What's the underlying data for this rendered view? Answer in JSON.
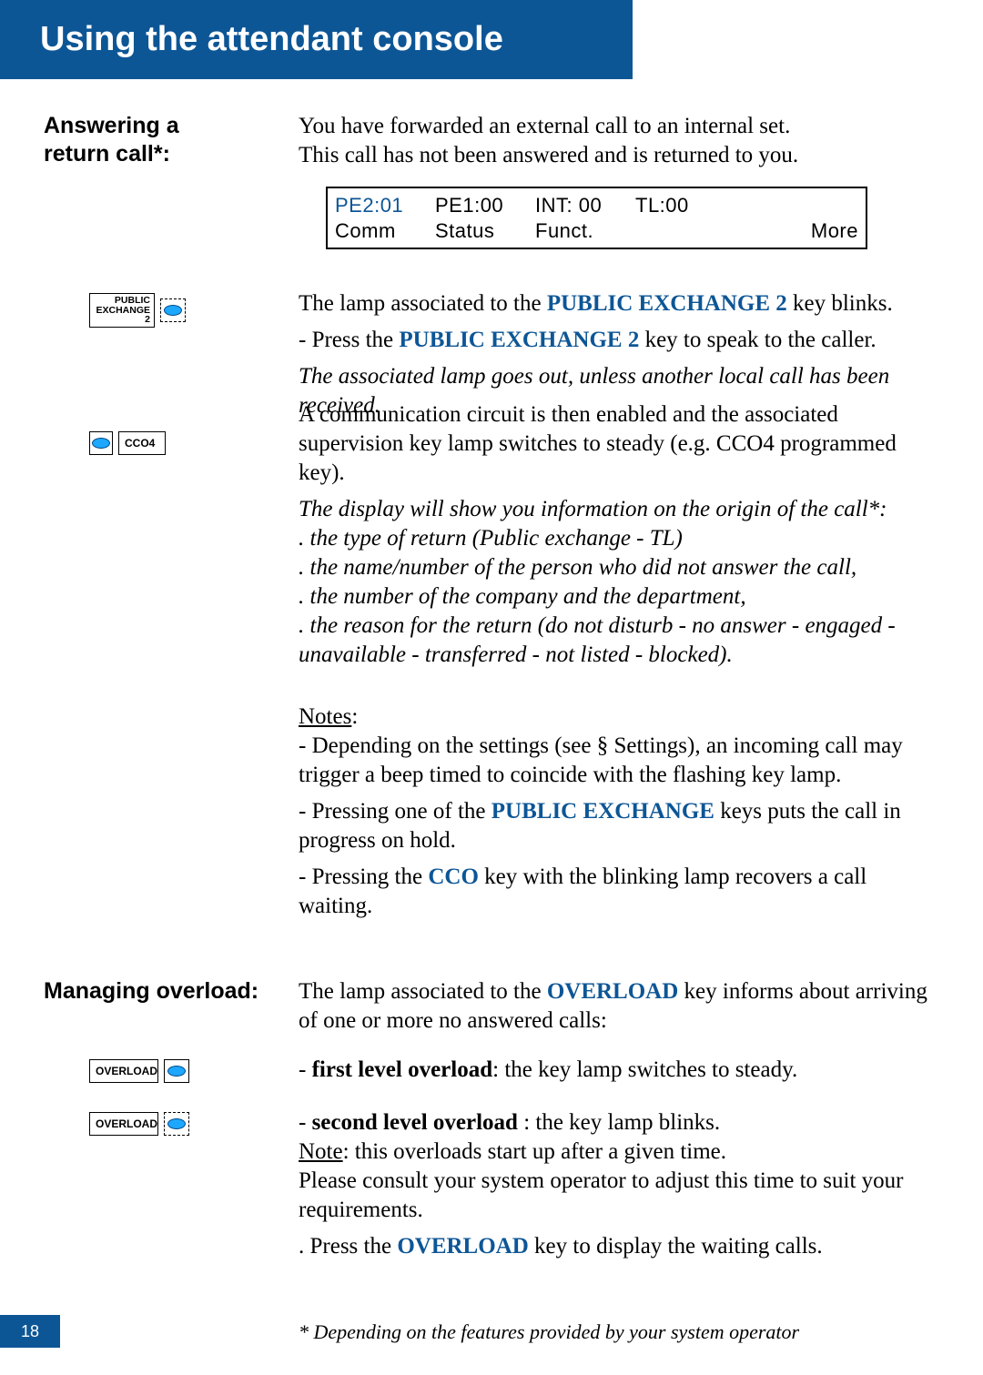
{
  "banner": "Using the attendant console",
  "sections": {
    "answering": {
      "heading_line1": "Answering a",
      "heading_line2": "return call*:",
      "intro_line1": "You have forwarded an external call to an internal set.",
      "intro_line2": "This call has not been answered and is returned to you.",
      "lcd": {
        "pe2": "PE2:01",
        "pe1": "PE1:00",
        "int": "INT: 00",
        "tl": "TL:00",
        "comm": "Comm",
        "status": "Status",
        "funct": "Funct.",
        "more": "More"
      },
      "key_pe2_line1": "PUBLIC",
      "key_pe2_line2": "EXCHANGE 2",
      "key_cco4": "CCO4",
      "lamp_text_1a": "The lamp associated to the ",
      "lamp_text_1b_bold": "PUBLIC EXCHANGE 2",
      "lamp_text_1c": " key blinks.",
      "press_1a": "- Press the ",
      "press_1b_bold": "PUBLIC EXCHANGE 2",
      "press_1c": " key to speak to the caller.",
      "italic1": "The associated lamp goes out, unless another local call has been received.",
      "circuit": "A communication circuit is then enabled and the associated supervision key lamp switches to steady (e.g. CCO4 programmed key).",
      "disp_intro": "The display will show you information on the origin of the call*:",
      "disp_b1": ". the type of return (Public exchange - TL)",
      "disp_b2": ". the name/number of the person who did not answer the call,",
      "disp_b3": ". the number of the company and the department,",
      "disp_b4": ". the reason for the return (do not disturb - no answer - engaged - unavailable - transferred - not listed - blocked).",
      "notes_label": "Notes",
      "note1": "- Depending on the settings (see § Settings), an incoming call may trigger a beep timed to coincide with the flashing key lamp.",
      "note2a": "- Pressing one of the ",
      "note2b_bold": "PUBLIC EXCHANGE",
      "note2c": " keys puts the call in progress on hold.",
      "note3a": "- Pressing the ",
      "note3b_bold": "CCO",
      "note3c": " key with the blinking lamp recovers a call waiting."
    },
    "overload": {
      "heading": "Managing overload:",
      "intro_a": "The lamp associated to the ",
      "intro_b_bold": "OVERLOAD",
      "intro_c": " key informs about arriving of one or more no answered calls:",
      "key_label": "OVERLOAD",
      "first_a": "- ",
      "first_b_bold": "first level overload",
      "first_c": ": the key lamp switches to steady.",
      "second_a": "- ",
      "second_b_bold": "second level overload ",
      "second_c": ": the key lamp blinks.",
      "note_label": "Note",
      "note_text": ": this overloads start up after a given time.",
      "consult": "Please consult your system operator to adjust this time to suit your requirements.",
      "press_a": ". Press the ",
      "press_b_bold": "OVERLOAD",
      "press_c": " key to display the waiting calls."
    }
  },
  "footer": {
    "page": "18",
    "footnote": "* Depending on the features provided by your system operator"
  }
}
